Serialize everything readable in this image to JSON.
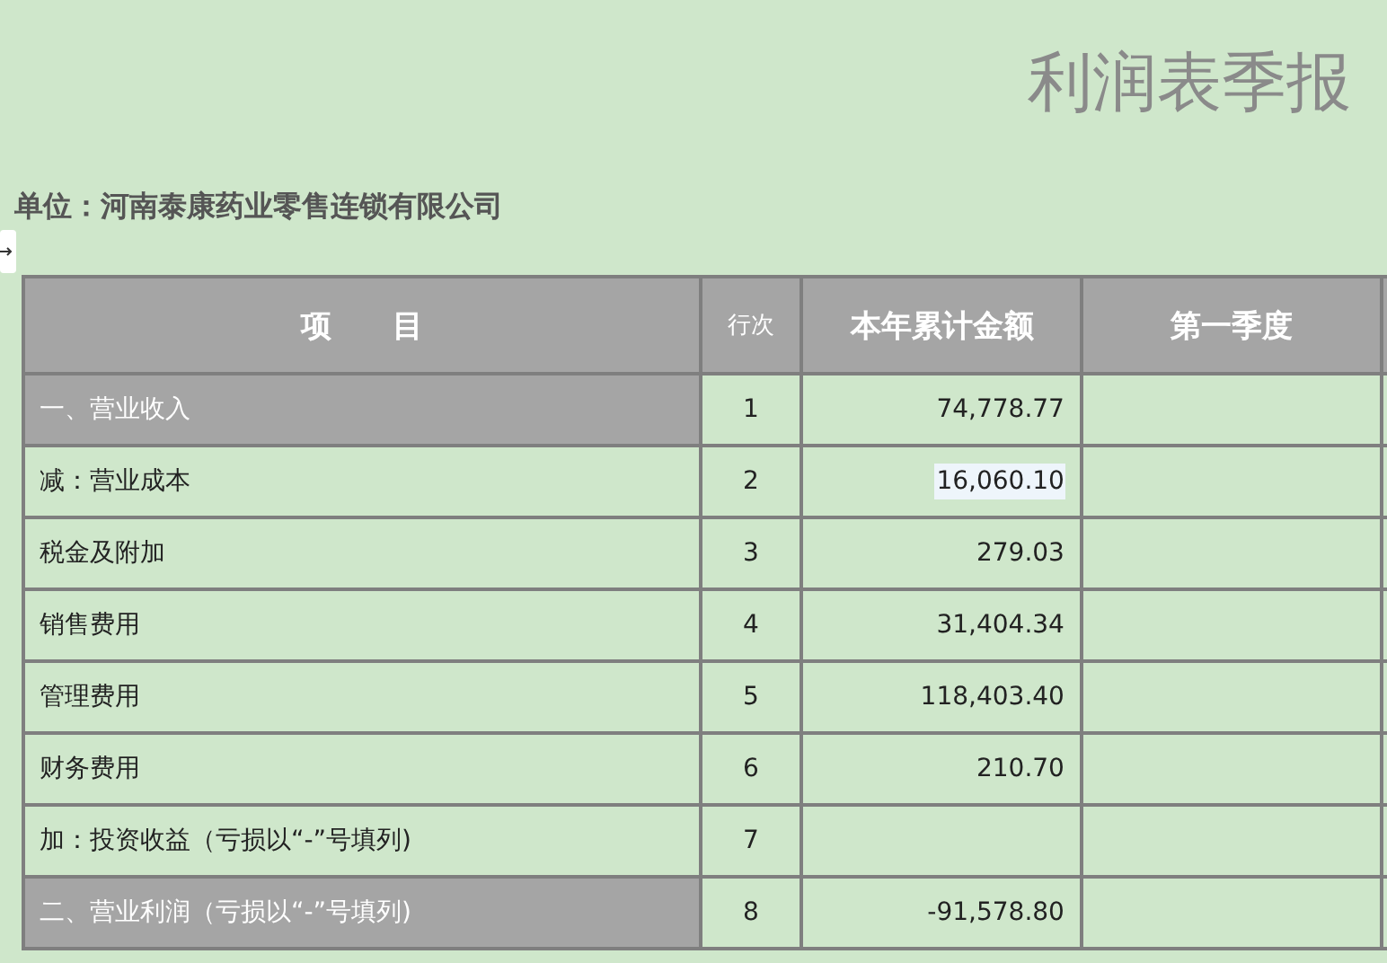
{
  "title": "利润表季报",
  "unit": "单位：河南泰康药业零售连锁有限公司",
  "table": {
    "columns": [
      "项　　目",
      "行次",
      "本年累计金额",
      "第一季度"
    ],
    "rows": [
      {
        "item": "一、营业收入",
        "line": "1",
        "amount": "74,778.77",
        "kind": "total",
        "selected": false
      },
      {
        "item": "减：营业成本",
        "line": "2",
        "amount": "16,060.10",
        "kind": "normal",
        "selected": true
      },
      {
        "item": "税金及附加",
        "line": "3",
        "amount": "279.03",
        "kind": "normal",
        "selected": false
      },
      {
        "item": "销售费用",
        "line": "4",
        "amount": "31,404.34",
        "kind": "normal",
        "selected": false
      },
      {
        "item": "管理费用",
        "line": "5",
        "amount": "118,403.40",
        "kind": "normal",
        "selected": false
      },
      {
        "item": "财务费用",
        "line": "6",
        "amount": "210.70",
        "kind": "normal",
        "selected": false
      },
      {
        "item": "加：投资收益（亏损以“-”号填列)",
        "line": "7",
        "kind": "normal",
        "selected": false
      },
      {
        "item": "二、营业利润（亏损以“-”号填列)",
        "line": "8",
        "amount": "-91,578.80",
        "kind": "total",
        "selected": false
      }
    ]
  }
}
